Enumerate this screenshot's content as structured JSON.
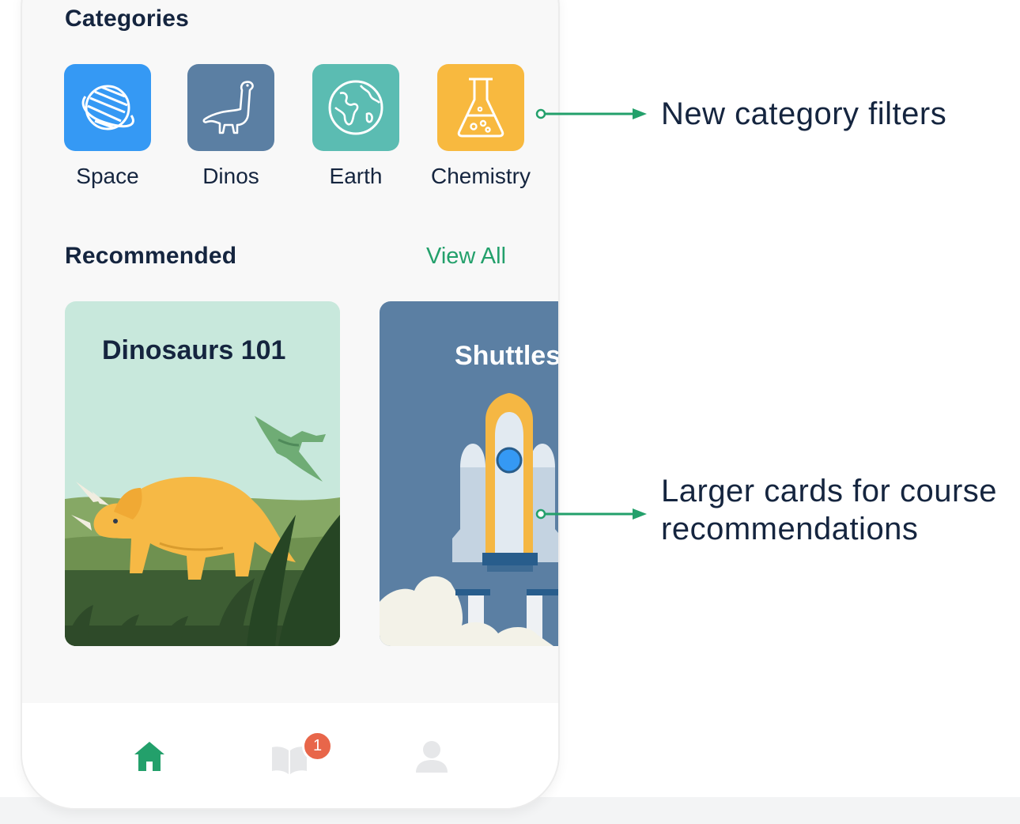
{
  "categories_title": "Categories",
  "categories": [
    {
      "label": "Space",
      "icon": "planet-icon",
      "color": "#3599f4"
    },
    {
      "label": "Dinos",
      "icon": "dinosaur-icon",
      "color": "#5b7fa3"
    },
    {
      "label": "Earth",
      "icon": "globe-icon",
      "color": "#5bbcb2"
    },
    {
      "label": "Chemistry",
      "icon": "flask-icon",
      "color": "#f8b93f"
    }
  ],
  "recommended": {
    "title": "Recommended",
    "view_all": "View All",
    "cards": [
      {
        "title": "Dinosaurs 101",
        "bg": "#c8e8dc"
      },
      {
        "title": "Shuttles",
        "bg": "#5b7fa3"
      }
    ]
  },
  "tabbar": {
    "items": [
      {
        "icon": "home-icon",
        "active": true
      },
      {
        "icon": "book-icon",
        "active": false,
        "badge": "1"
      },
      {
        "icon": "profile-icon",
        "active": false
      }
    ]
  },
  "annotations": {
    "category_filters": "New category filters",
    "larger_cards_line1": "Larger cards for course",
    "larger_cards_line2": "recommendations"
  },
  "colors": {
    "accent": "#23a06b",
    "text": "#15253f",
    "badge": "#e8664a"
  }
}
